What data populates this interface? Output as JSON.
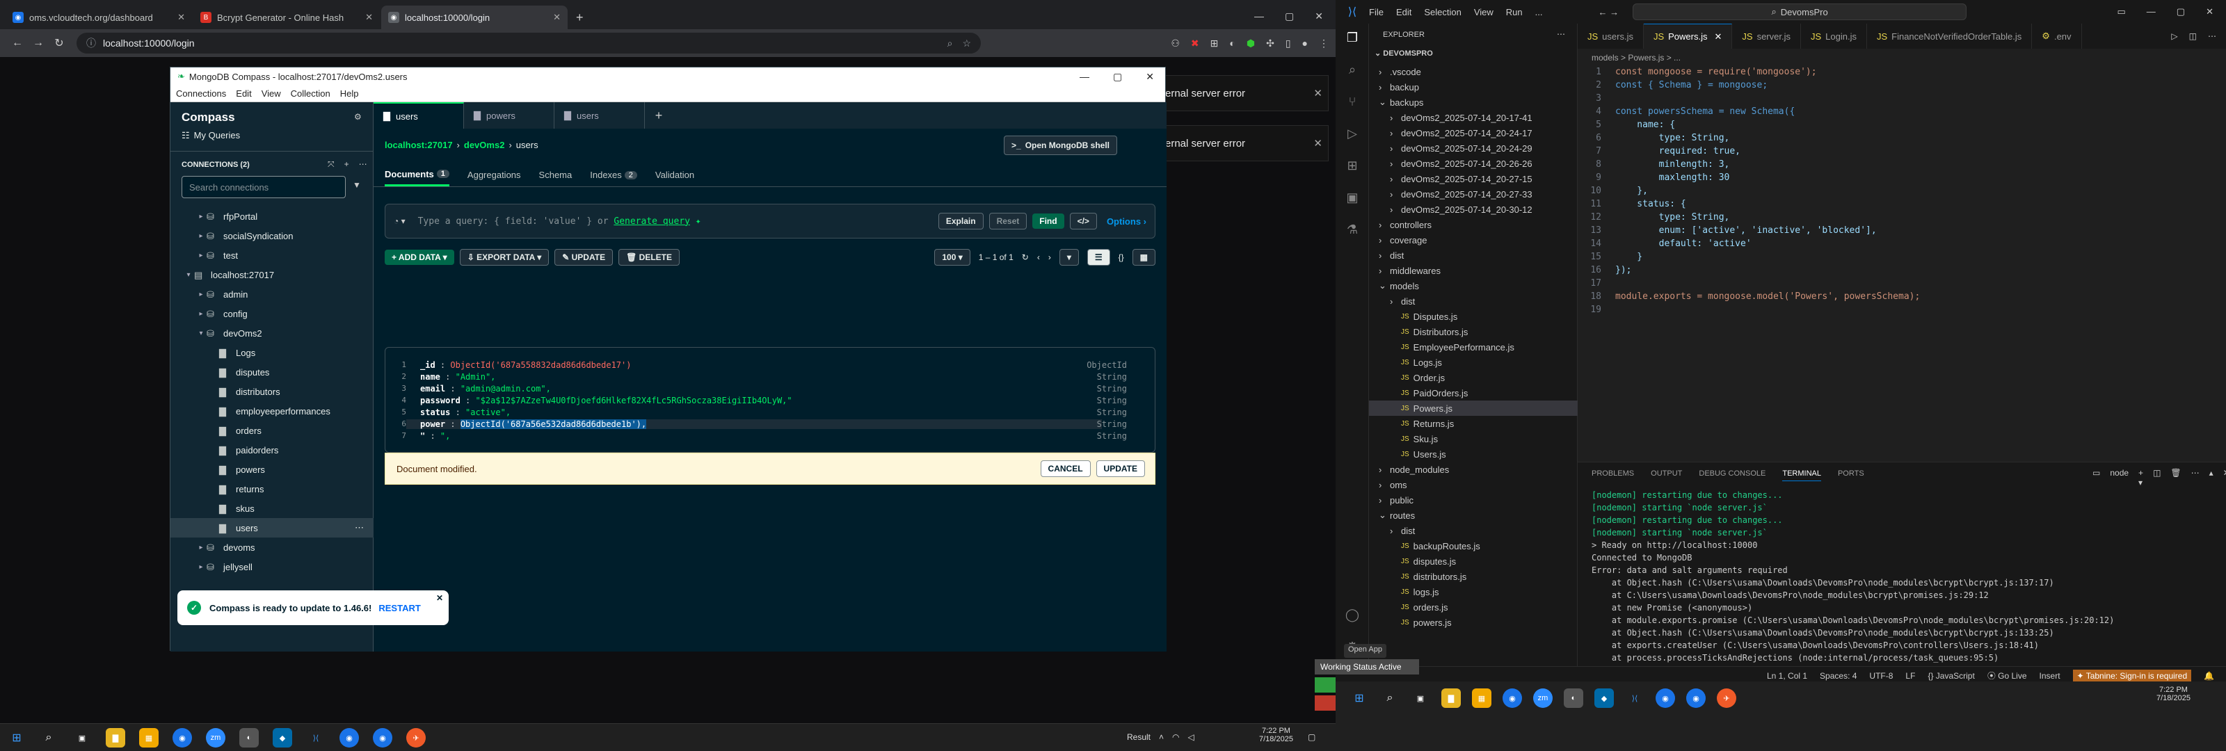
{
  "browser": {
    "tabs": [
      {
        "title": "oms.vcloudtech.org/dashboard",
        "icon": "globe-icon"
      },
      {
        "title": "Bcrypt Generator - Online Hash",
        "icon": "hash-icon"
      },
      {
        "title": "localhost:10000/login",
        "icon": "globe-icon"
      }
    ],
    "new_tab": "+",
    "url": "localhost:10000/login",
    "errors": [
      "ernal server error",
      "ernal server error"
    ]
  },
  "compass": {
    "window_title": "MongoDB Compass - localhost:27017/devOms2.users",
    "menu": [
      "Connections",
      "Edit",
      "View",
      "Collection",
      "Help"
    ],
    "app_name": "Compass",
    "my_queries": "My Queries",
    "connections_label": "CONNECTIONS (2)",
    "search_placeholder": "Search connections",
    "tree": [
      {
        "label": "rfpPortal",
        "level": 1
      },
      {
        "label": "socialSyndication",
        "level": 1
      },
      {
        "label": "test",
        "level": 1
      },
      {
        "label": "localhost:27017",
        "level": 0
      },
      {
        "label": "admin",
        "level": 1
      },
      {
        "label": "config",
        "level": 1
      },
      {
        "label": "devOms2",
        "level": 1
      },
      {
        "label": "Logs",
        "level": 2
      },
      {
        "label": "disputes",
        "level": 2
      },
      {
        "label": "distributors",
        "level": 2
      },
      {
        "label": "employeeperformances",
        "level": 2
      },
      {
        "label": "orders",
        "level": 2
      },
      {
        "label": "paidorders",
        "level": 2
      },
      {
        "label": "powers",
        "level": 2
      },
      {
        "label": "returns",
        "level": 2
      },
      {
        "label": "skus",
        "level": 2
      },
      {
        "label": "users",
        "level": 2
      },
      {
        "label": "devoms",
        "level": 1
      },
      {
        "label": "jellysell",
        "level": 1
      }
    ],
    "tabs": [
      "users",
      "powers",
      "users"
    ],
    "breadcrumb": [
      "localhost:27017",
      "devOms2",
      "users"
    ],
    "shell_button": "Open MongoDB shell",
    "subtabs": [
      {
        "label": "Documents",
        "count": "1"
      },
      {
        "label": "Aggregations",
        "count": ""
      },
      {
        "label": "Schema",
        "count": ""
      },
      {
        "label": "Indexes",
        "count": "2"
      },
      {
        "label": "Validation",
        "count": ""
      }
    ],
    "query_placeholder": "Type a query: { field: 'value' } or",
    "generate_query": "Generate query",
    "explain": "Explain",
    "reset": "Reset",
    "find": "Find",
    "options": "Options",
    "add_data": "ADD DATA",
    "export_data": "EXPORT DATA",
    "update": "UPDATE",
    "delete": "DELETE",
    "page_size": "100",
    "page_range": "1 – 1 of 1",
    "doc": [
      {
        "n": "1",
        "key": "_id",
        "value": "ObjectId('687a558832dad86d6dbede17')",
        "type": "ObjectId"
      },
      {
        "n": "2",
        "key": "name",
        "value": "\"Admin\",",
        "type": "String"
      },
      {
        "n": "3",
        "key": "email",
        "value": "\"admin@admin.com\",",
        "type": "String"
      },
      {
        "n": "4",
        "key": "password",
        "value": "\"$2a$12$7AZzeTw4U0fDjoefd6Hlkef82X4fLc5RGhSocza38EigiIIb4OLyW,\"",
        "type": "String"
      },
      {
        "n": "5",
        "key": "status",
        "value": "\"active\",",
        "type": "String"
      },
      {
        "n": "6",
        "key": "power",
        "value": "ObjectId('687a56e532dad86d6dbede1b'),",
        "type": "String"
      },
      {
        "n": "7",
        "key": "\"",
        "value": "\",",
        "type": "String"
      }
    ],
    "modified_text": "Document modified.",
    "cancel": "CANCEL",
    "update_doc": "UPDATE",
    "toast_text": "Compass is ready to update to 1.46.6!",
    "toast_action": "RESTART"
  },
  "vscode": {
    "menu": [
      "File",
      "Edit",
      "Selection",
      "View",
      "Run",
      "..."
    ],
    "search": "DevomsPro",
    "explorer_title": "EXPLORER",
    "root": "DEVOMSPRO",
    "tree": [
      {
        "label": ".vscode",
        "level": 0,
        "folder": true,
        "open": false
      },
      {
        "label": "backup",
        "level": 0,
        "folder": true,
        "open": false
      },
      {
        "label": "backups",
        "level": 0,
        "folder": true,
        "open": true
      },
      {
        "label": "devOms2_2025-07-14_20-17-41",
        "level": 1,
        "folder": true,
        "open": false
      },
      {
        "label": "devOms2_2025-07-14_20-24-17",
        "level": 1,
        "folder": true,
        "open": false
      },
      {
        "label": "devOms2_2025-07-14_20-24-29",
        "level": 1,
        "folder": true,
        "open": false
      },
      {
        "label": "devOms2_2025-07-14_20-26-26",
        "level": 1,
        "folder": true,
        "open": false
      },
      {
        "label": "devOms2_2025-07-14_20-27-15",
        "level": 1,
        "folder": true,
        "open": false
      },
      {
        "label": "devOms2_2025-07-14_20-27-33",
        "level": 1,
        "folder": true,
        "open": false
      },
      {
        "label": "devOms2_2025-07-14_20-30-12",
        "level": 1,
        "folder": true,
        "open": false
      },
      {
        "label": "controllers",
        "level": 0,
        "folder": true,
        "open": false
      },
      {
        "label": "coverage",
        "level": 0,
        "folder": true,
        "open": false
      },
      {
        "label": "dist",
        "level": 0,
        "folder": true,
        "open": false
      },
      {
        "label": "middlewares",
        "level": 0,
        "folder": true,
        "open": false
      },
      {
        "label": "models",
        "level": 0,
        "folder": true,
        "open": true
      },
      {
        "label": "dist",
        "level": 1,
        "folder": true,
        "open": false
      },
      {
        "label": "Disputes.js",
        "level": 1,
        "folder": false
      },
      {
        "label": "Distributors.js",
        "level": 1,
        "folder": false
      },
      {
        "label": "EmployeePerformance.js",
        "level": 1,
        "folder": false
      },
      {
        "label": "Logs.js",
        "level": 1,
        "folder": false
      },
      {
        "label": "Order.js",
        "level": 1,
        "folder": false
      },
      {
        "label": "PaidOrders.js",
        "level": 1,
        "folder": false
      },
      {
        "label": "Powers.js",
        "level": 1,
        "folder": false
      },
      {
        "label": "Returns.js",
        "level": 1,
        "folder": false
      },
      {
        "label": "Sku.js",
        "level": 1,
        "folder": false
      },
      {
        "label": "Users.js",
        "level": 1,
        "folder": false
      },
      {
        "label": "node_modules",
        "level": 0,
        "folder": true,
        "open": false
      },
      {
        "label": "oms",
        "level": 0,
        "folder": true,
        "open": false
      },
      {
        "label": "public",
        "level": 0,
        "folder": true,
        "open": false
      },
      {
        "label": "routes",
        "level": 0,
        "folder": true,
        "open": true
      },
      {
        "label": "dist",
        "level": 1,
        "folder": true,
        "open": false
      },
      {
        "label": "backupRoutes.js",
        "level": 1,
        "folder": false
      },
      {
        "label": "disputes.js",
        "level": 1,
        "folder": false
      },
      {
        "label": "distributors.js",
        "level": 1,
        "folder": false
      },
      {
        "label": "logs.js",
        "level": 1,
        "folder": false
      },
      {
        "label": "orders.js",
        "level": 1,
        "folder": false
      },
      {
        "label": "powers.js",
        "level": 1,
        "folder": false
      }
    ],
    "tabs": [
      "users.js",
      "Powers.js",
      "server.js",
      "Login.js",
      "FinanceNotVerifiedOrderTable.js",
      ".env"
    ],
    "breadcrumb": "models > Powers.js > ...",
    "code": [
      "const mongoose = require('mongoose');",
      "const { Schema } = mongoose;",
      "",
      "const powersSchema = new Schema({",
      "    name: {",
      "        type: String,",
      "        required: true,",
      "        minlength: 3,",
      "        maxlength: 30",
      "    },",
      "    status: {",
      "        type: String,",
      "        enum: ['active', 'inactive', 'blocked'],",
      "        default: 'active'",
      "    }",
      "});",
      "",
      "module.exports = mongoose.model('Powers', powersSchema);",
      ""
    ],
    "panel_tabs": [
      "PROBLEMS",
      "OUTPUT",
      "DEBUG CONSOLE",
      "TERMINAL",
      "PORTS"
    ],
    "terminal_label": "node",
    "terminal": [
      "[nodemon] restarting due to changes...",
      "[nodemon] starting `node server.js`",
      "[nodemon] restarting due to changes...",
      "[nodemon] starting `node server.js`",
      "> Ready on http://localhost:10000",
      "Connected to MongoDB",
      "Error: data and salt arguments required",
      "    at Object.hash (C:\\Users\\usama\\Downloads\\DevomsPro\\node_modules\\bcrypt\\bcrypt.js:137:17)",
      "    at C:\\Users\\usama\\Downloads\\DevomsPro\\node_modules\\bcrypt\\promises.js:29:12",
      "    at new Promise (<anonymous>)",
      "    at module.exports.promise (C:\\Users\\usama\\Downloads\\DevomsPro\\node_modules\\bcrypt\\promises.js:20:12)",
      "    at Object.hash (C:\\Users\\usama\\Downloads\\DevomsPro\\node_modules\\bcrypt\\bcrypt.js:133:25)",
      "    at exports.createUser (C:\\Users\\usama\\Downloads\\DevomsPro\\controllers\\Users.js:18:41)",
      "    at process.processTicksAndRejections (node:internal/process/task_queues:95:5)"
    ],
    "status_items": [
      "Ln 1, Col 1",
      "Spaces: 4",
      "UTF-8",
      "LF",
      "{} JavaScript",
      "Go Live",
      "Insert",
      "Tabnine: Sign-in is required"
    ],
    "open_app": "Open App",
    "working_status": "Working Status Active"
  },
  "taskbar": {
    "left_result": "Result",
    "left_time": "7:22 PM",
    "left_date": "7/18/2025",
    "right_time": "7:22 PM",
    "right_date": "7/18/2025"
  }
}
